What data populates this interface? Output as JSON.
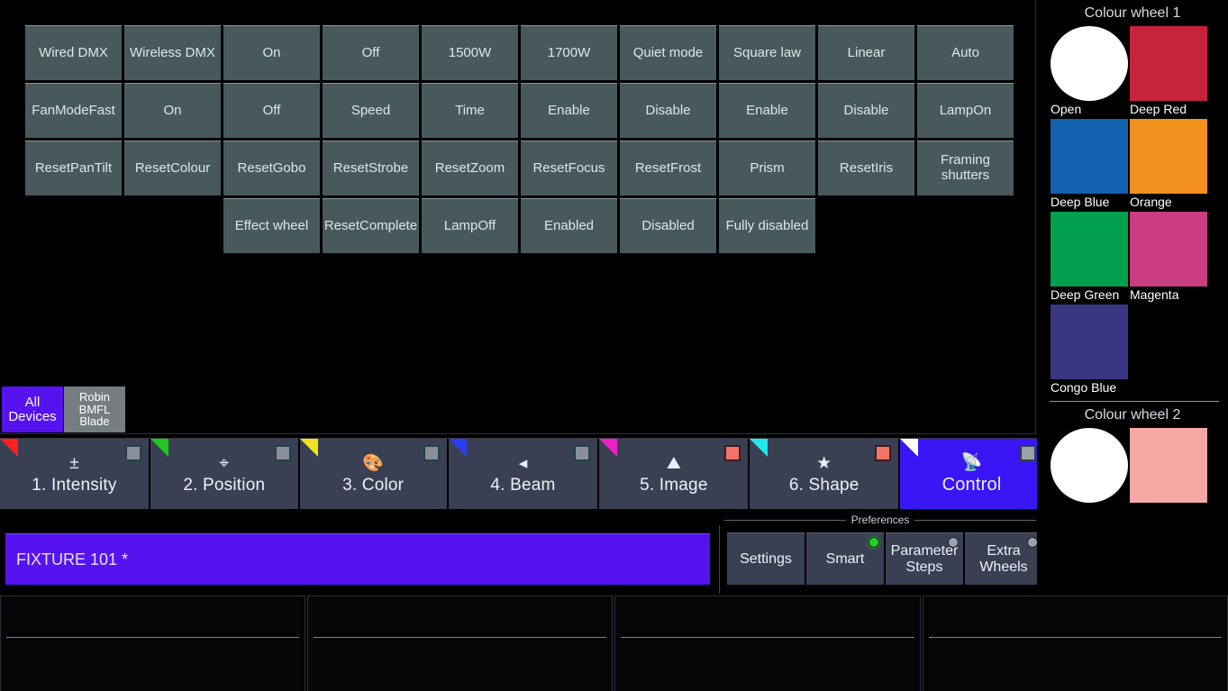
{
  "value_grid": {
    "rows": [
      [
        {
          "label": "Wired DMX"
        },
        {
          "label": "Wireless DMX"
        },
        {
          "label": "On"
        },
        {
          "label": "Off"
        },
        {
          "label": "1500W"
        },
        {
          "label": "1700W"
        },
        {
          "label": "Quiet mode"
        },
        {
          "label": "Square law"
        },
        {
          "label": "Linear"
        },
        {
          "label": "Auto"
        }
      ],
      [
        {
          "label": "FanModeFast"
        },
        {
          "label": "On"
        },
        {
          "label": "Off"
        },
        {
          "label": "Speed"
        },
        {
          "label": "Time"
        },
        {
          "label": "Enable"
        },
        {
          "label": "Disable"
        },
        {
          "label": "Enable"
        },
        {
          "label": "Disable"
        },
        {
          "label": "LampOn"
        }
      ],
      [
        {
          "label": "ResetPanTilt"
        },
        {
          "label": "ResetColour"
        },
        {
          "label": "ResetGobo"
        },
        {
          "label": "ResetStrobe"
        },
        {
          "label": "ResetZoom"
        },
        {
          "label": "ResetFocus"
        },
        {
          "label": "ResetFrost"
        },
        {
          "label": "Prism"
        },
        {
          "label": "ResetIris"
        },
        {
          "label": "Framing shutters"
        }
      ],
      [
        {
          "label": "",
          "spacer": true
        },
        {
          "label": "",
          "spacer": true
        },
        {
          "label": "Effect wheel"
        },
        {
          "label": "ResetComplete"
        },
        {
          "label": "LampOff"
        },
        {
          "label": "Enabled"
        },
        {
          "label": "Disabled"
        },
        {
          "label": "Fully disabled"
        },
        {
          "label": "",
          "spacer": true
        },
        {
          "label": "",
          "spacer": true
        }
      ]
    ]
  },
  "device_bar": {
    "items": [
      {
        "label": "All Devices",
        "selected": true
      },
      {
        "label": "Robin BMFL Blade",
        "selected": false
      }
    ]
  },
  "tabs": [
    {
      "label": "1. Intensity",
      "icon": "intensity-icon",
      "glyph": "±",
      "corner": "#ff2020",
      "led": "grey",
      "selected": false
    },
    {
      "label": "2. Position",
      "icon": "crosshair-icon",
      "glyph": "⌖",
      "corner": "#22c522",
      "led": "grey",
      "selected": false
    },
    {
      "label": "3. Color",
      "icon": "palette-icon",
      "glyph": "🎨",
      "corner": "#f0e21e",
      "led": "grey",
      "selected": false
    },
    {
      "label": "4. Beam",
      "icon": "beam-cone-icon",
      "glyph": "◂",
      "corner": "#2a3df0",
      "led": "grey",
      "selected": false
    },
    {
      "label": "5. Image",
      "icon": "gobo-image-icon",
      "glyph": "⛰",
      "corner": "#f020c8",
      "led": "red",
      "selected": false
    },
    {
      "label": "6. Shape",
      "icon": "star-shape-icon",
      "glyph": "★",
      "corner": "#20e8e8",
      "led": "red",
      "selected": false
    },
    {
      "label": "Control",
      "icon": "control-satellite-icon",
      "glyph": "📡",
      "corner": "#ffffff",
      "led": "on",
      "selected": true
    }
  ],
  "fixture": {
    "label": "FIXTURE 101 *"
  },
  "preferences": {
    "legend": "Preferences",
    "buttons": [
      {
        "label": "Settings",
        "led": null
      },
      {
        "label": "Smart",
        "led": "green"
      },
      {
        "label": "Parameter Steps",
        "led": "grey"
      },
      {
        "label": "Extra Wheels",
        "led": "grey"
      }
    ]
  },
  "colour_wheel_1": {
    "title": "Colour wheel 1",
    "swatches": [
      {
        "label": "Open",
        "color": "#ffffff",
        "shape": "circle"
      },
      {
        "label": "Deep Red",
        "color": "#c8233c",
        "shape": "square"
      },
      {
        "label": "Deep Blue",
        "color": "#1360ae",
        "shape": "square"
      },
      {
        "label": "Orange",
        "color": "#f3911e",
        "shape": "square"
      },
      {
        "label": "Deep Green",
        "color": "#00a04f",
        "shape": "square"
      },
      {
        "label": "Magenta",
        "color": "#ca3d82",
        "shape": "square"
      },
      {
        "label": "Congo Blue",
        "color": "#3b3682",
        "shape": "square"
      }
    ]
  },
  "colour_wheel_2": {
    "title": "Colour wheel 2",
    "swatches": [
      {
        "label": "",
        "color": "#ffffff",
        "shape": "circle"
      },
      {
        "label": "",
        "color": "#f5a8a4",
        "shape": "square"
      }
    ]
  },
  "sidebar_device": {
    "label": "Robin BMFL Blade"
  },
  "bottom_panels": [
    {
      "label": ""
    },
    {
      "label": ""
    },
    {
      "label": ""
    },
    {
      "label": ""
    }
  ]
}
